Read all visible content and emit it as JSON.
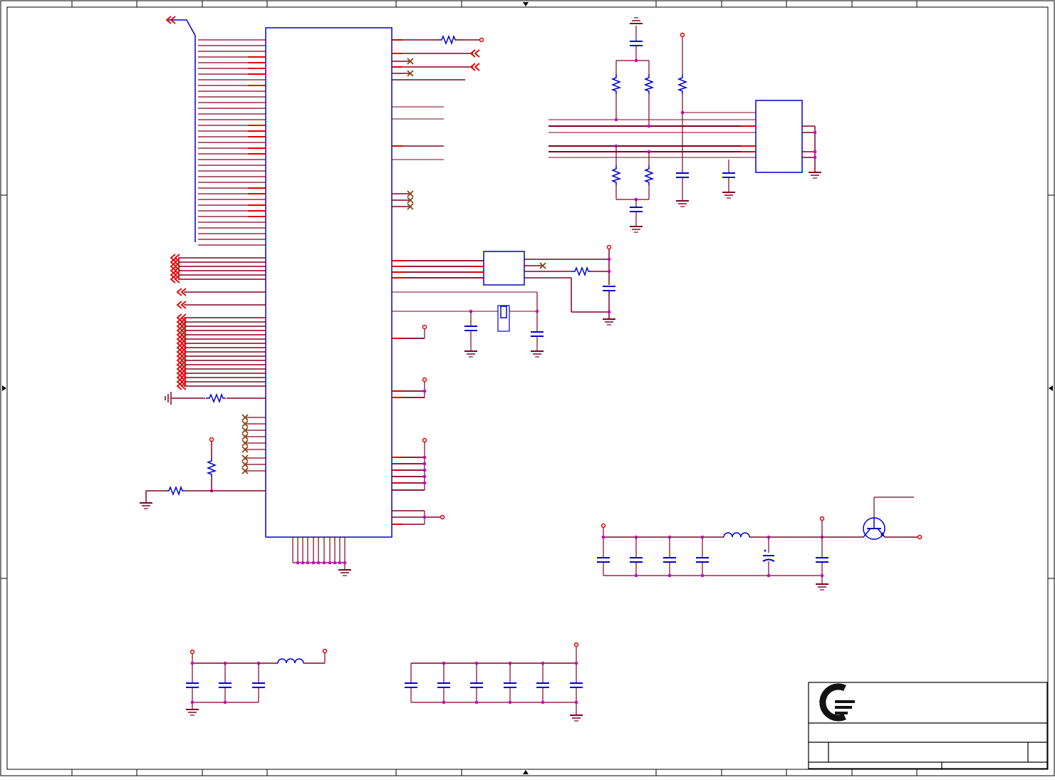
{
  "sheet": {
    "title": "",
    "colors": {
      "frame": "#000000",
      "component": "#0000cc",
      "wire": "#800020",
      "pin": "#e00000",
      "junction": "#cc00cc",
      "noconnect": "#8b4513",
      "logo": "#111111"
    }
  },
  "title_block": {
    "logo_icon": "company-logo-icon",
    "company": "",
    "title": "",
    "size": "",
    "document_number": "",
    "revision": "",
    "date": "",
    "sheet": ""
  },
  "icons": [
    "ground-icon",
    "power-port-icon",
    "off-page-connector-icon",
    "no-connect-icon",
    "resistor-icon",
    "capacitor-icon",
    "inductor-icon",
    "crystal-icon",
    "transistor-icon"
  ]
}
